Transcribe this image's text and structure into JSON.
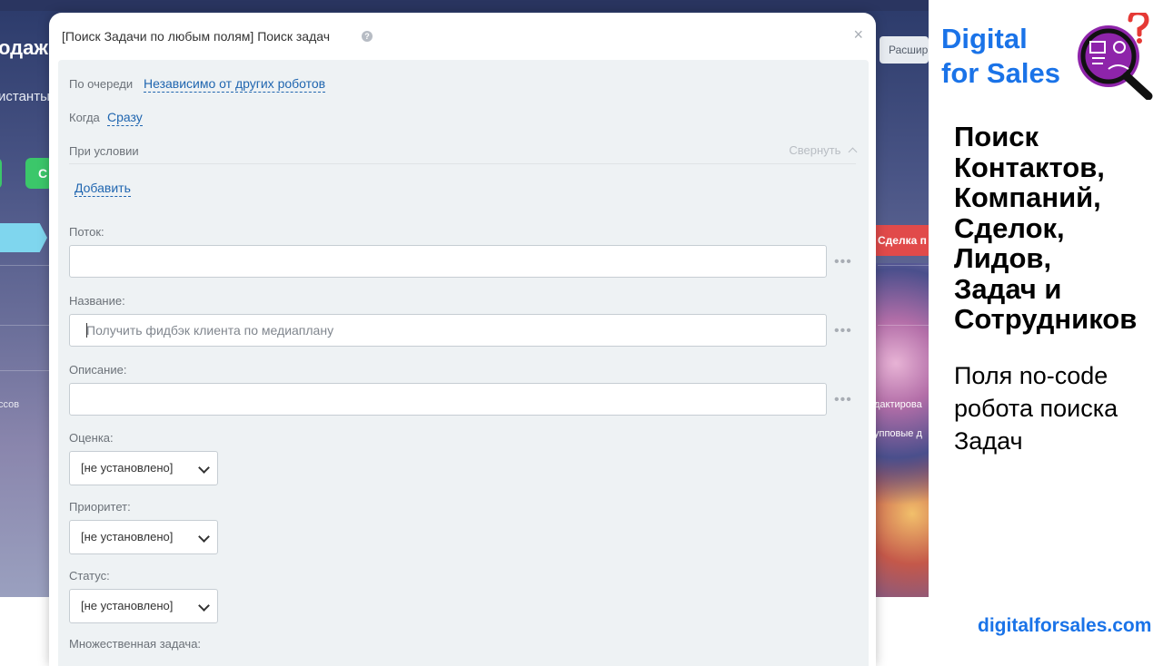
{
  "background_app": {
    "title_fragment": "одаж",
    "assistants_fragment": "истанты",
    "green_button_fragment": "С",
    "processes_fragment": "ссов",
    "expand_button_fragment": "Расшир",
    "deal_badge_fragment": "Сделка п",
    "edit_fragment": "дактирова",
    "group_fragment": "упповые д"
  },
  "modal": {
    "title": "[Поиск Задачи по любым полям] Поиск задач",
    "help_glyph": "?",
    "close_glyph": "×",
    "queue": {
      "label": "По очереди",
      "value": "Независимо от других роботов"
    },
    "when": {
      "label": "Когда",
      "value": "Сразу"
    },
    "condition": {
      "label": "При условии",
      "collapse_label": "Свернуть",
      "add_label": "Добавить"
    },
    "fields": [
      {
        "label": "Поток:",
        "value": "",
        "placeholder": ""
      },
      {
        "label": "Название:",
        "value": "Получить фидбэк клиента по медиаплану",
        "placeholder": ""
      },
      {
        "label": "Описание:",
        "value": "",
        "placeholder": ""
      }
    ],
    "dots_glyph": "•••",
    "selects": [
      {
        "label": "Оценка:",
        "value": "[не установлено]"
      },
      {
        "label": "Приоритет:",
        "value": "[не установлено]"
      },
      {
        "label": "Статус:",
        "value": "[не установлено]"
      }
    ],
    "multi_task_label": "Множественная задача:"
  },
  "promo": {
    "brand_line1": "Digital",
    "brand_line2": "for Sales",
    "title": "Поиск\nКонтактов,\nКомпаний,\nСделок,\nЛидов,\nЗадач и\nСотрудников",
    "subtitle": "Поля no-code\nробота поиска\nЗадач",
    "website": "digitalforsales.com"
  },
  "colors": {
    "brand_blue": "#1a73e8",
    "link_blue": "#2066b0",
    "logo_purple": "#8e24aa",
    "question_red": "#e53935"
  }
}
